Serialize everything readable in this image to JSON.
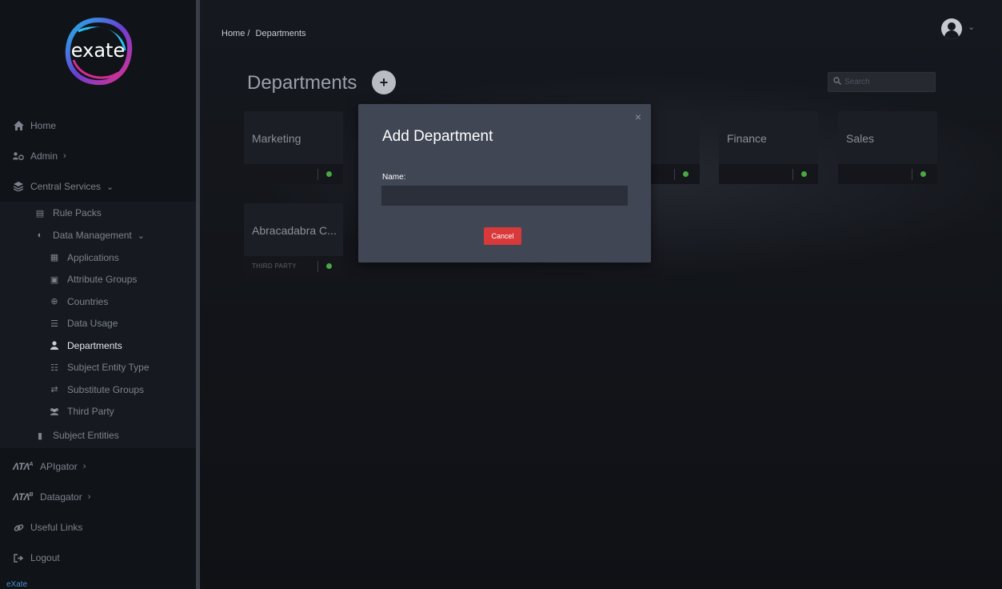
{
  "app": {
    "logo_text": "exate",
    "footer_brand": "eXate"
  },
  "sidebar": {
    "items": [
      {
        "label": "Home",
        "icon": "home-icon"
      },
      {
        "label": "Admin",
        "icon": "users-gear-icon"
      },
      {
        "label": "Central Services",
        "icon": "layers-icon"
      }
    ],
    "central_services": {
      "rule_packs": "Rule Packs",
      "data_management": "Data Management",
      "data_management_items": [
        {
          "label": "Applications",
          "icon": "grid-icon"
        },
        {
          "label": "Attribute Groups",
          "icon": "id-card-icon"
        },
        {
          "label": "Countries",
          "icon": "globe-icon"
        },
        {
          "label": "Data Usage",
          "icon": "list-icon"
        },
        {
          "label": "Departments",
          "icon": "user-icon",
          "active": true
        },
        {
          "label": "Subject Entity Type",
          "icon": "bullet-list-icon"
        },
        {
          "label": "Substitute Groups",
          "icon": "swap-icon"
        },
        {
          "label": "Third Party",
          "icon": "group-icon"
        }
      ],
      "subject_entities": "Subject Entities"
    },
    "bottom_items": [
      {
        "label": "APIgator",
        "brand": "ΛTΛ",
        "sup": "A"
      },
      {
        "label": "Datagator",
        "brand": "ΛTΛ",
        "sup": "B"
      },
      {
        "label": "Useful Links",
        "icon": "link-icon"
      },
      {
        "label": "Logout",
        "icon": "logout-icon"
      }
    ]
  },
  "header": {
    "breadcrumb": [
      "Home /",
      "Departments"
    ],
    "title": "Departments",
    "add_label": "+",
    "search_placeholder": "Search"
  },
  "cards": [
    {
      "name": "Marketing",
      "tag": ""
    },
    {
      "name": "",
      "tag": ""
    },
    {
      "name": "",
      "tag": ""
    },
    {
      "name": "Finance",
      "tag": ""
    },
    {
      "name": "Sales",
      "tag": ""
    },
    {
      "name": "Abracadabra C...",
      "tag": "THIRD PARTY"
    }
  ],
  "modal": {
    "title": "Add Department",
    "close": "×",
    "name_label": "Name:",
    "name_value": "",
    "cancel_label": "Cancel"
  },
  "colors": {
    "status_active": "#48a843",
    "cancel": "#d9393a",
    "modal_bg": "#404654"
  }
}
